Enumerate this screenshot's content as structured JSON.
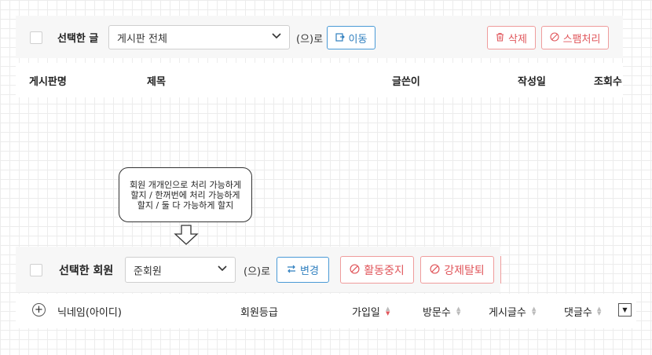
{
  "post_bar": {
    "selected_label": "선택한 글",
    "board_select_value": "게시판 전체",
    "suffix": "(으)로",
    "move_label": "이동",
    "delete_label": "삭제",
    "spam_label": "스팸처리"
  },
  "post_table": {
    "headers": [
      "게시판명",
      "제목",
      "글쓴이",
      "작성일",
      "조회수"
    ]
  },
  "callout": {
    "lines": [
      "회원 개개인으로 처리 가능하게",
      "할지 / 한꺼번에 처리 가능하게",
      "할지 / 둘 다 가능하게 할지"
    ]
  },
  "member_bar": {
    "selected_label": "선택한 회원",
    "grade_select_value": "준회원",
    "suffix": "(으)로",
    "change_label": "변경",
    "suspend_label": "활동중지",
    "withdraw_label": "강제탈퇴"
  },
  "member_table": {
    "headers": [
      "닉네임(아이디)",
      "회원등급",
      "가입일",
      "방문수",
      "게시글수",
      "댓글수"
    ]
  },
  "colors": {
    "accent_blue": "#2f7fbf",
    "danger_red": "#e0565b"
  },
  "icons": {
    "move": "move-icon",
    "delete": "trash-icon",
    "spam": "ban-icon",
    "change": "swap-icon",
    "suspend": "ban-icon",
    "withdraw": "ban-icon"
  }
}
